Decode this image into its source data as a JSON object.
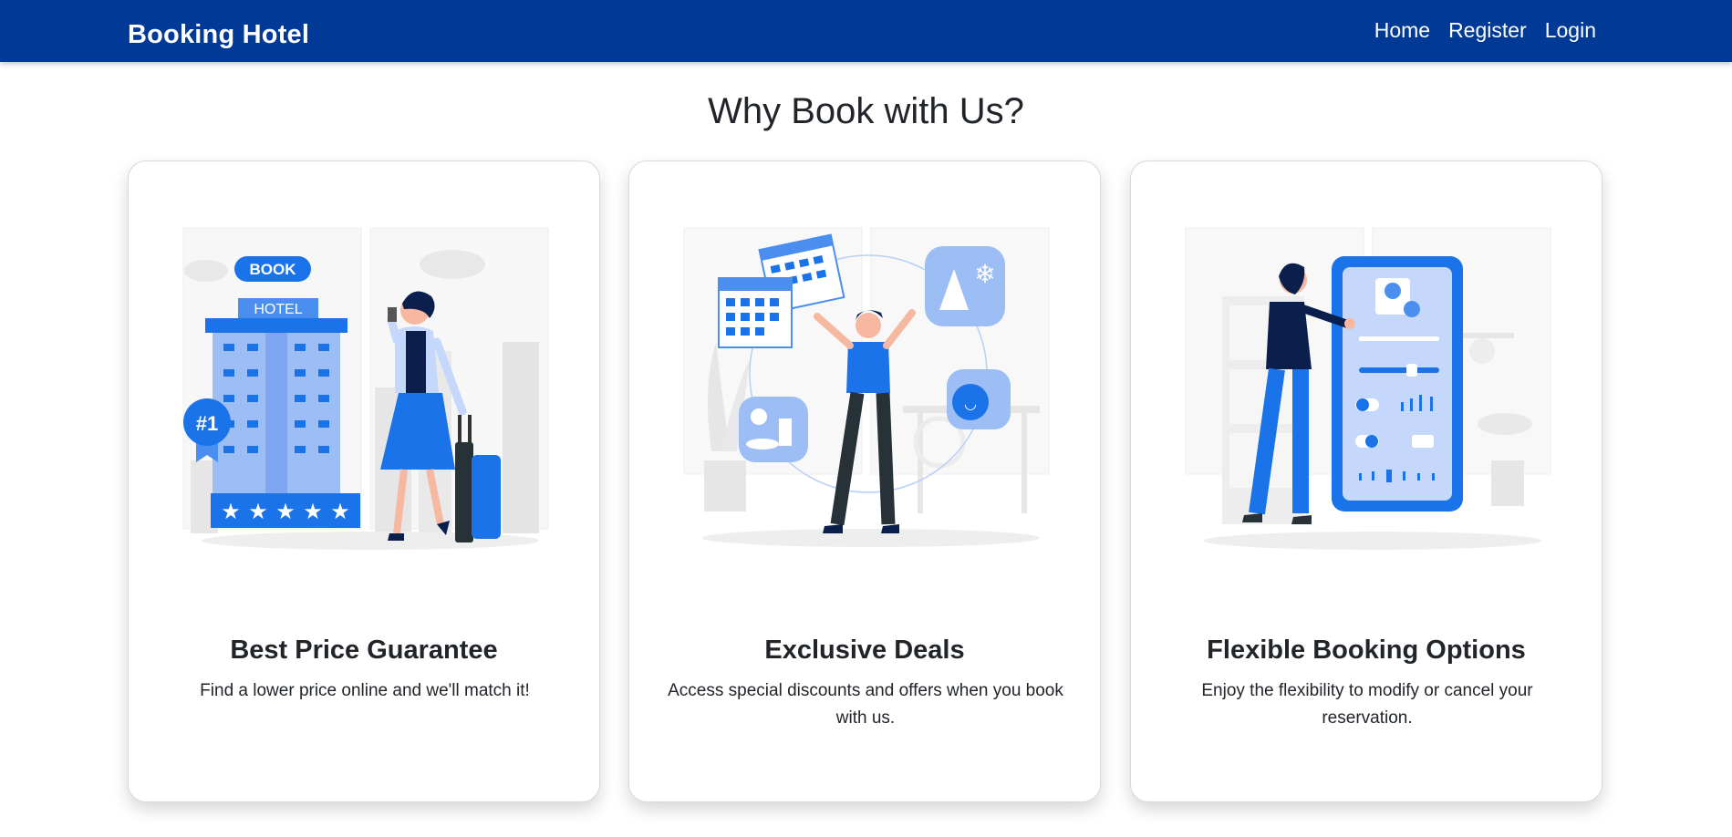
{
  "navbar": {
    "brand": "Booking Hotel",
    "links": [
      "Home",
      "Register",
      "Login"
    ]
  },
  "section": {
    "title": "Why Book with Us?"
  },
  "cards": [
    {
      "title": "Best Price Guarantee",
      "text": "Find a lower price online and we'll match it!",
      "illustration_labels": [
        "BOOK",
        "HOTEL",
        "#1"
      ]
    },
    {
      "title": "Exclusive Deals",
      "text": "Access special discounts and offers when you book with us."
    },
    {
      "title": "Flexible Booking Options",
      "text": "Enjoy the flexibility to modify or cancel your reservation."
    }
  ],
  "colors": {
    "navbar": "#003a96",
    "accent": "#1a73e8",
    "accent_light": "#9dbdf5",
    "dark_navy": "#0b1f4d"
  }
}
